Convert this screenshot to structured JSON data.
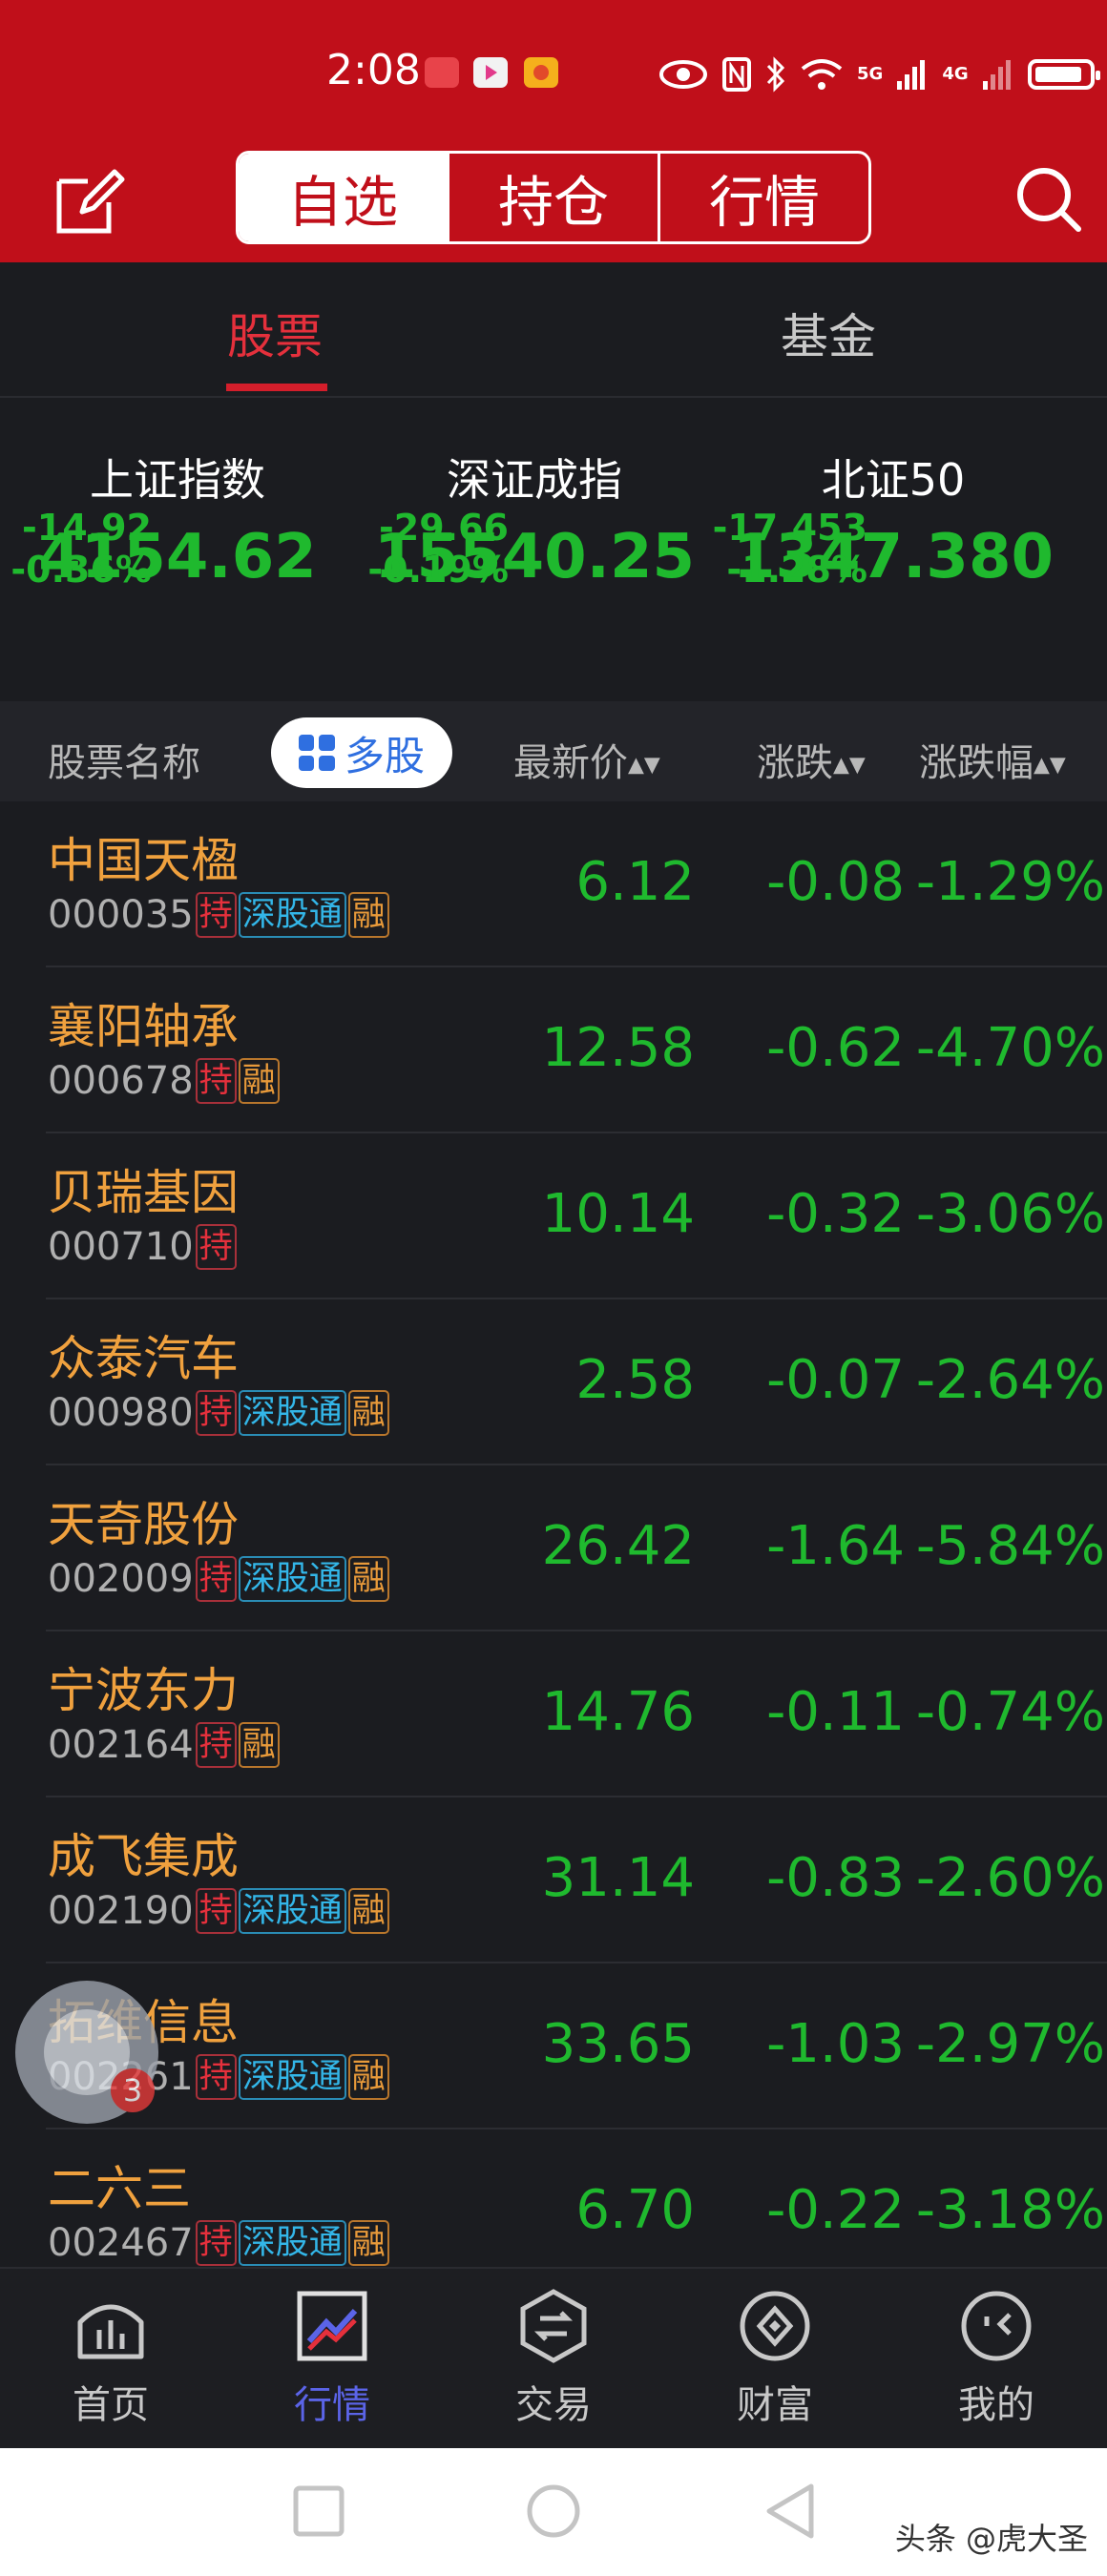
{
  "status": {
    "time": "2:08",
    "net1": "5G",
    "net2": "4G"
  },
  "top_tabs": [
    "自选",
    "持仓",
    "行情"
  ],
  "sub_tabs": {
    "stocks": "股票",
    "funds": "基金"
  },
  "indices": [
    {
      "name": "上证指数",
      "value": "4154.62",
      "change": "-14.92",
      "pct": "-0.36%"
    },
    {
      "name": "深证成指",
      "value": "15540.25",
      "change": "-29.66",
      "pct": "-0.19%"
    },
    {
      "name": "北证50",
      "value": "1347.380",
      "change": "-17.453",
      "pct": "-1.28%"
    }
  ],
  "columns": {
    "name": "股票名称",
    "multi": "多股",
    "price": "最新价",
    "change": "涨跌",
    "pct": "涨跌幅"
  },
  "tag_labels": {
    "hold": "持",
    "sgt": "深股通",
    "rong": "融"
  },
  "stocks": [
    {
      "name": "中国天楹",
      "code": "000035",
      "price": "6.12",
      "change": "-0.08",
      "pct": "-1.29%",
      "tags": [
        "hold",
        "sgt",
        "rong"
      ]
    },
    {
      "name": "襄阳轴承",
      "code": "000678",
      "price": "12.58",
      "change": "-0.62",
      "pct": "-4.70%",
      "tags": [
        "hold",
        "rong"
      ]
    },
    {
      "name": "贝瑞基因",
      "code": "000710",
      "price": "10.14",
      "change": "-0.32",
      "pct": "-3.06%",
      "tags": [
        "hold"
      ]
    },
    {
      "name": "众泰汽车",
      "code": "000980",
      "price": "2.58",
      "change": "-0.07",
      "pct": "-2.64%",
      "tags": [
        "hold",
        "sgt",
        "rong"
      ]
    },
    {
      "name": "天奇股份",
      "code": "002009",
      "price": "26.42",
      "change": "-1.64",
      "pct": "-5.84%",
      "tags": [
        "hold",
        "sgt",
        "rong"
      ]
    },
    {
      "name": "宁波东力",
      "code": "002164",
      "price": "14.76",
      "change": "-0.11",
      "pct": "-0.74%",
      "tags": [
        "hold",
        "rong"
      ]
    },
    {
      "name": "成飞集成",
      "code": "002190",
      "price": "31.14",
      "change": "-0.83",
      "pct": "-2.60%",
      "tags": [
        "hold",
        "sgt",
        "rong"
      ]
    },
    {
      "name": "拓维信息",
      "code": "002261",
      "price": "33.65",
      "change": "-1.03",
      "pct": "-2.97%",
      "tags": [
        "hold",
        "sgt",
        "rong"
      ]
    },
    {
      "name": "二六三",
      "code": "002467",
      "price": "6.70",
      "change": "-0.22",
      "pct": "-3.18%",
      "tags": [
        "hold",
        "sgt",
        "rong"
      ]
    }
  ],
  "floating_badge": "3",
  "bottom_nav": [
    "首页",
    "行情",
    "交易",
    "财富",
    "我的"
  ],
  "watermark": "头条 @虎大圣",
  "colors": {
    "header": "#c00f1a",
    "down_green": "#1fb92e",
    "stock_name": "#f0a13e",
    "active_nav": "#5b64e8"
  }
}
